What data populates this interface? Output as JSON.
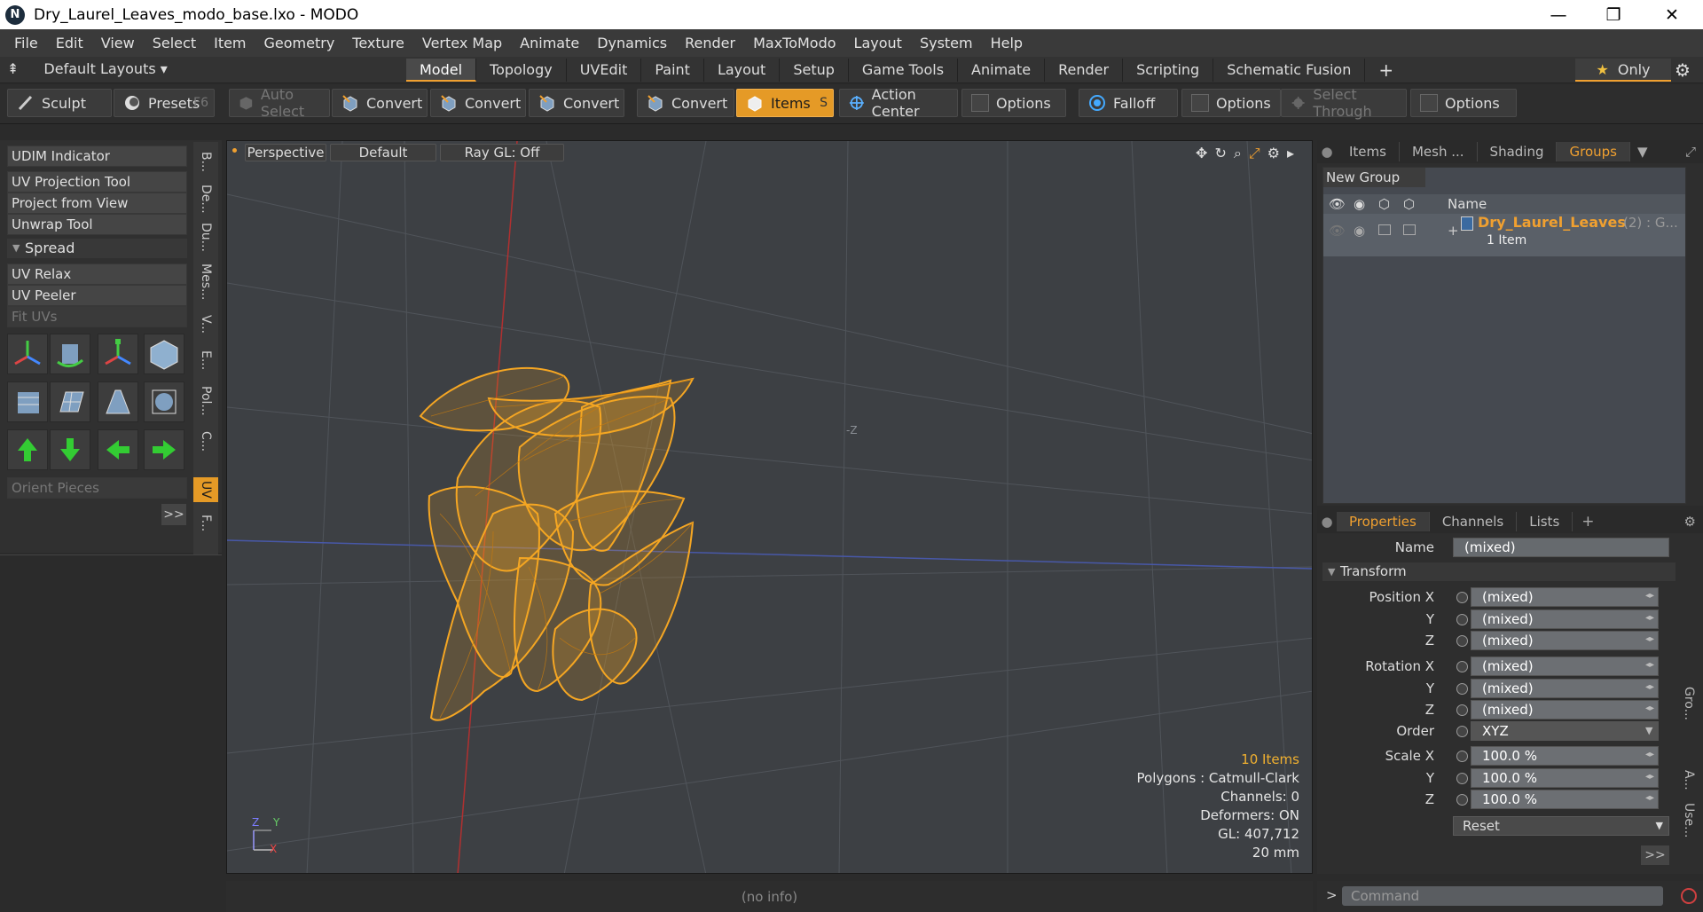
{
  "window": {
    "app_icon_letter": "N",
    "title": "Dry_Laurel_Leaves_modo_base.lxo - MODO",
    "minimize": "—",
    "restore": "❐",
    "close": "✕"
  },
  "menubar": {
    "items": [
      "File",
      "Edit",
      "View",
      "Select",
      "Item",
      "Geometry",
      "Texture",
      "Vertex Map",
      "Animate",
      "Dynamics",
      "Render",
      "MaxToModo",
      "Layout",
      "System",
      "Help"
    ]
  },
  "layouts": {
    "label": "Default Layouts ▾"
  },
  "tabs": {
    "items": [
      "Model",
      "Topology",
      "UVEdit",
      "Paint",
      "Layout",
      "Setup",
      "Game Tools",
      "Animate",
      "Render",
      "Scripting",
      "Schematic Fusion"
    ],
    "active": "Model",
    "add": "+"
  },
  "only_button": {
    "star": "★",
    "label": "Only"
  },
  "toolbar": {
    "sculpt": "Sculpt",
    "presets": "Presets",
    "presets_key": "F6",
    "auto_select": "Auto Select",
    "convert1": "Convert",
    "convert2": "Convert",
    "convert3": "Convert",
    "convert4": "Convert",
    "items": "Items",
    "items_key": "S",
    "action_center": "Action Center",
    "options1": "Options",
    "falloff": "Falloff",
    "options2": "Options",
    "select_through": "Select Through",
    "options3": "Options"
  },
  "leftpanel": {
    "udim": "UDIM Indicator",
    "uv_projection": "UV Projection Tool",
    "project_from_view": "Project from View",
    "unwrap": "Unwrap Tool",
    "spread": "Spread",
    "uv_relax": "UV Relax",
    "uv_peeler": "UV Peeler",
    "fit_uvs": "Fit UVs",
    "orient_pieces": "Orient Pieces",
    "more": ">>"
  },
  "vtabs": [
    "B...",
    "De...",
    "Du...",
    "Mes...",
    "V...",
    "E...",
    "Pol...",
    "C...",
    "UV",
    "F..."
  ],
  "viewport": {
    "perspective": "Perspective",
    "default": "Default",
    "raygl": "Ray GL: Off",
    "items_count": "10 Items",
    "polygons": "Polygons : Catmull-Clark",
    "channels": "Channels: 0",
    "deformers": "Deformers: ON",
    "gl": "GL: 407,712",
    "scale": "20 mm",
    "axis_z": "Z",
    "axis_y": "Y",
    "axis_x": "X",
    "neg_z": "-Z"
  },
  "status": {
    "info": "(no info)"
  },
  "rightpanel": {
    "tabs": [
      "Items",
      "Mesh ...",
      "Shading",
      "Groups"
    ],
    "active": "Groups",
    "new_group": "New Group",
    "col_name": "Name",
    "group_name": "Dry_Laurel_Leaves",
    "group_extra": "(2) : G...",
    "group_count": "1 Item"
  },
  "properties": {
    "tabs": [
      "Properties",
      "Channels",
      "Lists"
    ],
    "add": "+",
    "name_label": "Name",
    "name_value": "(mixed)",
    "transform": "Transform",
    "rows": [
      {
        "label": "Position X",
        "value": "(mixed)"
      },
      {
        "label": "Y",
        "value": "(mixed)"
      },
      {
        "label": "Z",
        "value": "(mixed)"
      },
      {
        "label": "Rotation X",
        "value": "(mixed)"
      },
      {
        "label": "Y",
        "value": "(mixed)"
      },
      {
        "label": "Z",
        "value": "(mixed)"
      },
      {
        "label": "Order",
        "value": "XYZ"
      },
      {
        "label": "Scale X",
        "value": "100.0 %"
      },
      {
        "label": "Y",
        "value": "100.0 %"
      },
      {
        "label": "Z",
        "value": "100.0 %"
      }
    ],
    "reset": "Reset",
    "more": ">>"
  },
  "rstrip": [
    "Gro...",
    "A...",
    "Use..."
  ],
  "command": {
    "prompt": ">",
    "placeholder": "Command"
  },
  "colors": {
    "accent": "#e59a26",
    "mesh": "#f5a623",
    "viewport_bg": "#3d4044"
  }
}
